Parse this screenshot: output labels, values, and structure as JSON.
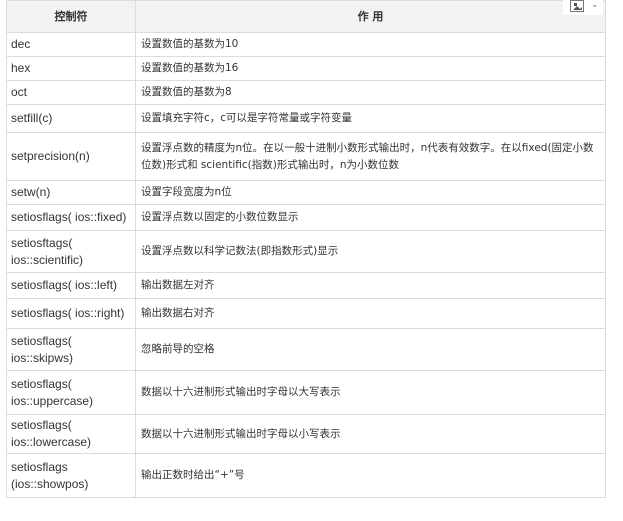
{
  "table": {
    "headers": [
      "控制符",
      "作 用"
    ],
    "rows": [
      {
        "code": "dec",
        "desc": "设置数值的基数为10"
      },
      {
        "code": "hex",
        "desc": "设置数值的基数为16"
      },
      {
        "code": "oct",
        "desc": "设置数值的基数为8"
      },
      {
        "code": "setfill(c)",
        "desc": "设置填充字符c，c可以是字符常量或字符变量"
      },
      {
        "code": "setprecision(n)",
        "desc": "设置浮点数的精度为n位。在以一般十进制小数形式输出时，n代表有效数字。在以fixed(固定小数位数)形式和 scientific(指数)形式输出时，n为小数位数"
      },
      {
        "code": "setw(n)",
        "desc": "设置字段宽度为n位"
      },
      {
        "code": "setiosflags( ios::fixed)",
        "desc": "设置浮点数以固定的小数位数显示"
      },
      {
        "code": "setiosftags( ios::scientific)",
        "desc": "设置浮点数以科学记数法(即指数形式)显示"
      },
      {
        "code": "setiosflags( ios::left)",
        "desc": "输出数据左对齐"
      },
      {
        "code": "setiosflags( ios::right)",
        "desc": "输出数据右对齐"
      },
      {
        "code": "setiosflags( ios::skipws)",
        "desc": "忽略前导的空格"
      },
      {
        "code": "setiosflags( ios::uppercase)",
        "desc": "数据以十六进制形式输出时字母以大写表示"
      },
      {
        "code": "setiosflags( ios::lowercase)",
        "desc": "数据以十六进制形式输出时字母以小写表示"
      },
      {
        "code": "setiosflags (ios::showpos)",
        "desc": "输出正数时给出“+”号"
      }
    ]
  },
  "toolbar": {
    "icons": [
      "image-icon",
      "chevron-down-icon"
    ],
    "chevron_glyph": "⌄"
  }
}
